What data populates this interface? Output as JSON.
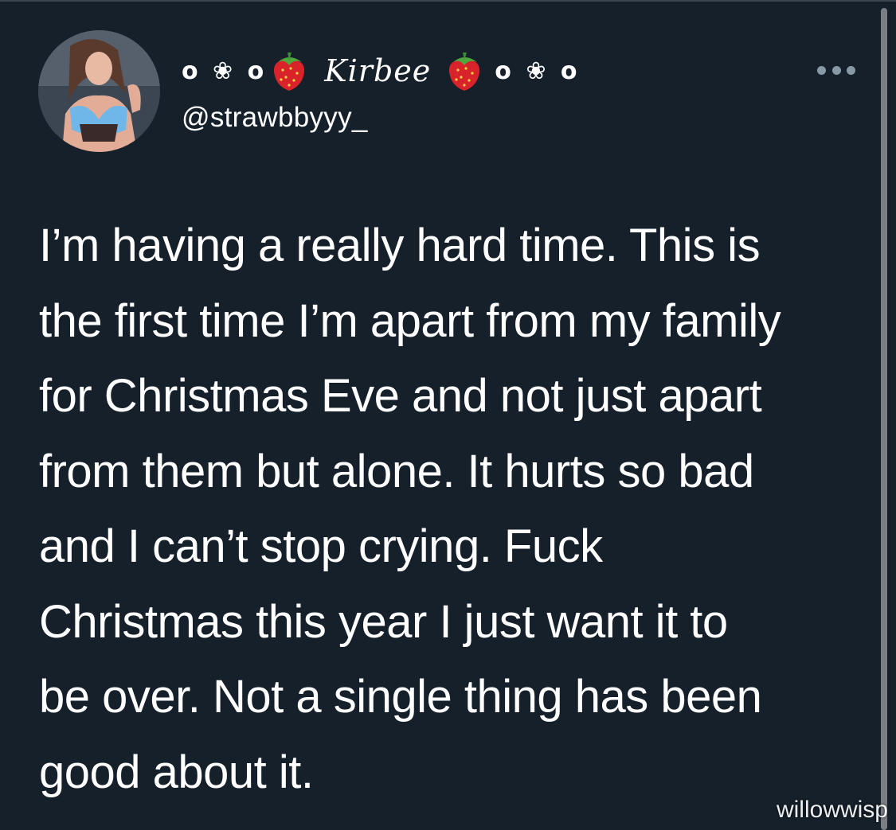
{
  "tweet": {
    "author": {
      "display_name_prefix": "o ❀ o",
      "display_name": "Kirbee",
      "display_name_suffix": "o ❀ o",
      "decoration_icon": "strawberry-icon",
      "handle": "@strawbbyyy_"
    },
    "more_icon": "more-horizontal-icon",
    "text_lines": [
      "I’m having a really hard time. This is",
      "the first time I’m apart from my family",
      "for Christmas Eve and not just apart",
      "from them but alone. It hurts so bad",
      "and I can’t stop crying. Fuck",
      "Christmas this year I just want it to",
      "be over. Not a single thing has been",
      "good about it."
    ]
  },
  "watermark": "willowwisp",
  "colors": {
    "background": "#15202b",
    "text": "#ffffff",
    "muted": "#8899a6",
    "strawberry": "#d8232a"
  }
}
